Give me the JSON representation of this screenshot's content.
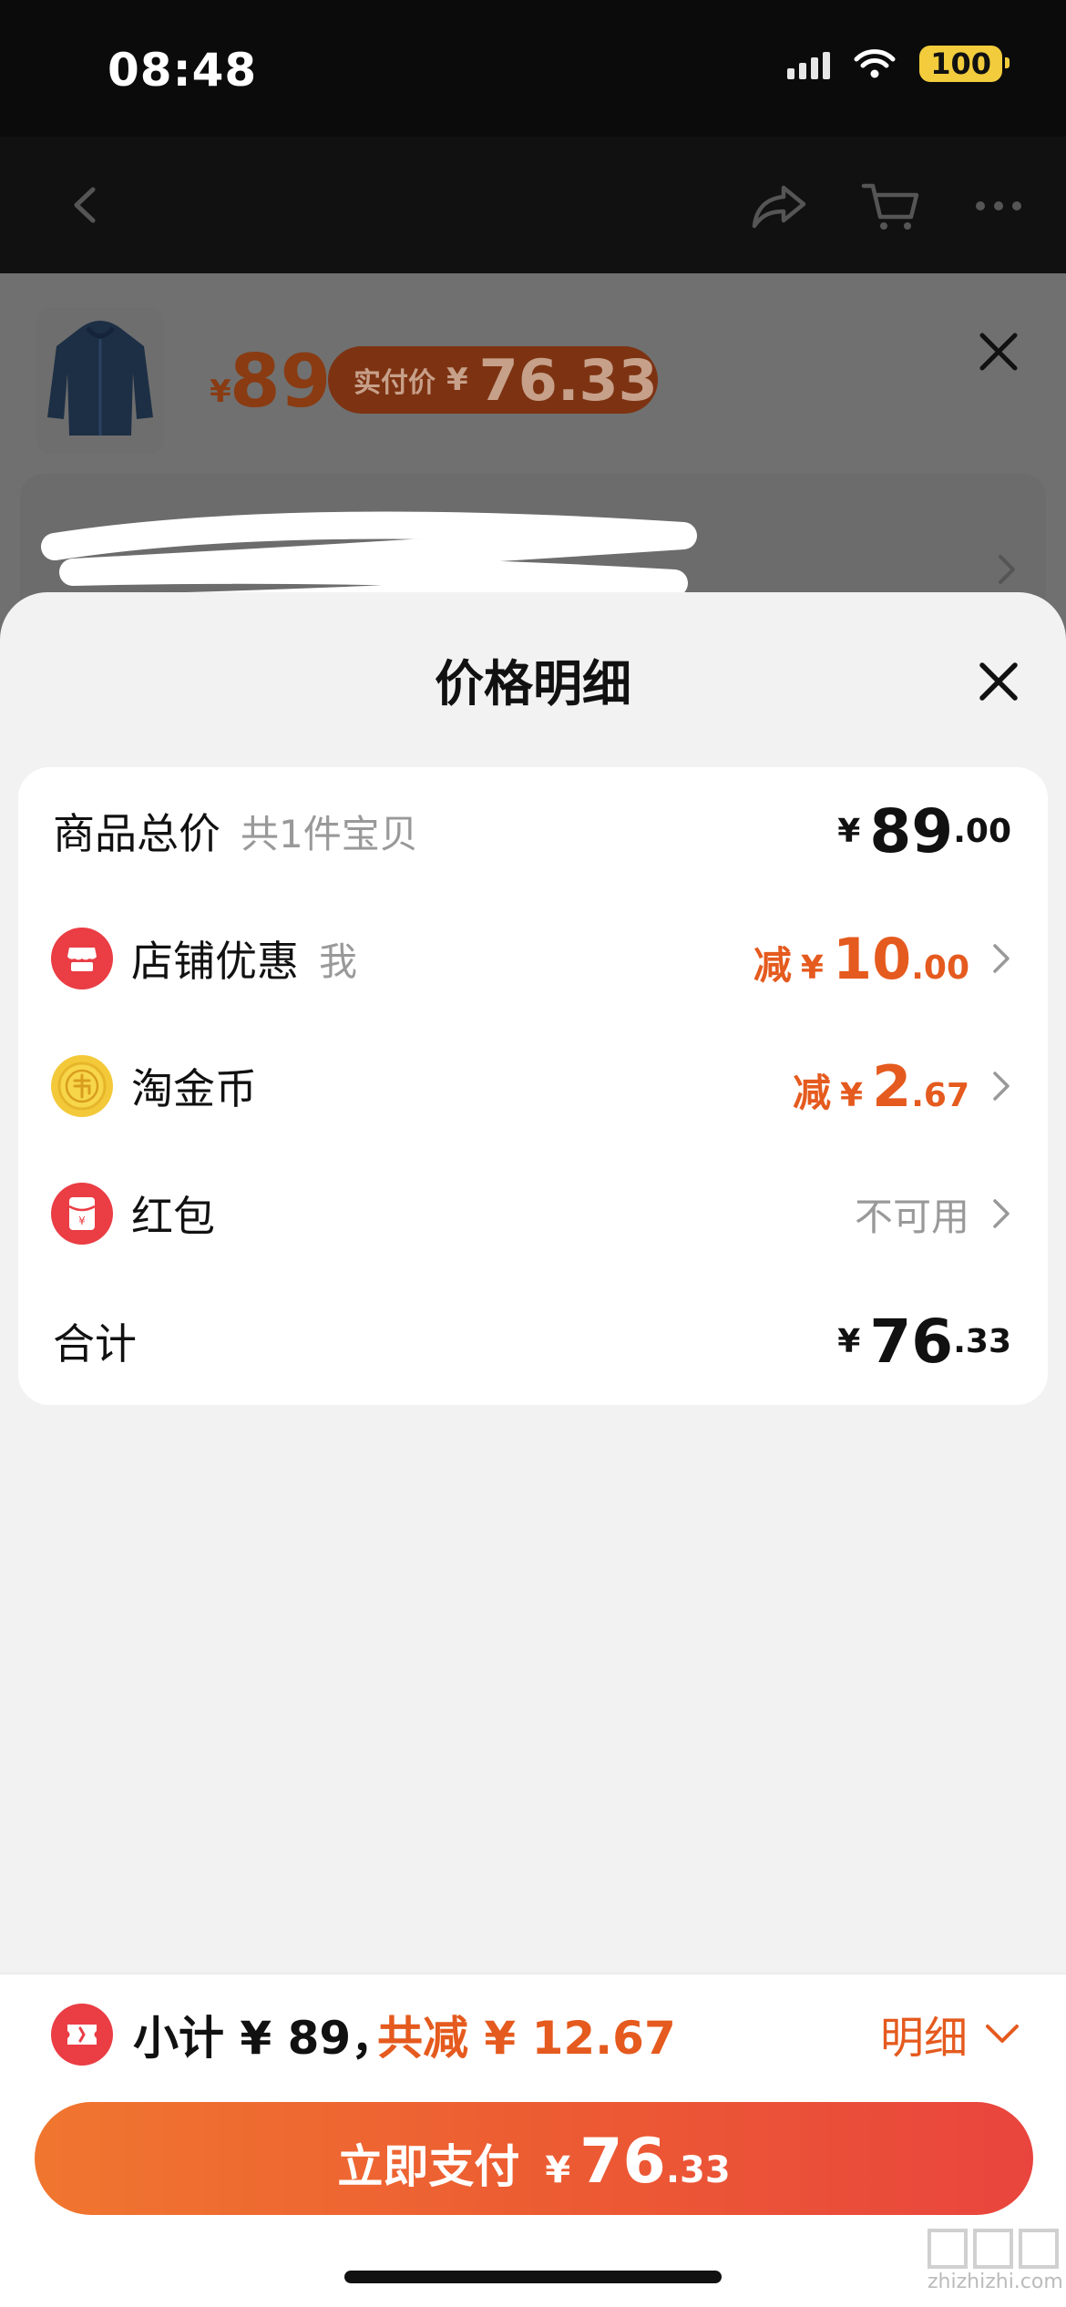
{
  "status": {
    "time": "08:48",
    "battery": "100"
  },
  "background": {
    "price_yen": "¥",
    "price": "89",
    "pill_label": "实付价",
    "pill_yen": "¥",
    "pill_price": "76.33"
  },
  "sheet": {
    "title": "价格明细",
    "rows": [
      {
        "label": "商品总价",
        "sub": "共1件宝贝",
        "yen": "¥",
        "int": "89",
        "dec": ".00"
      },
      {
        "label": "店铺优惠",
        "sub": "我",
        "prefix": "减",
        "yen": "¥",
        "int": "10",
        "dec": ".00"
      },
      {
        "label": "淘金币",
        "prefix": "减",
        "yen": "¥",
        "int": "2",
        "dec": ".67"
      },
      {
        "label": "红包",
        "status": "不可用"
      },
      {
        "label": "合计",
        "yen": "¥",
        "int": "76",
        "dec": ".33"
      }
    ]
  },
  "bottom": {
    "subtotal": "小计 ¥ 89，",
    "discount": "共减 ¥ 12.67",
    "detail": "明细",
    "pay_label": "立即支付",
    "pay_yen": "¥",
    "pay_int": "76",
    "pay_dec": ".33"
  },
  "watermark": "zhizhizhi.com",
  "colors": {
    "accent": "#e55a1e",
    "red": "#ea3d44",
    "coin": "#f3c93a"
  }
}
